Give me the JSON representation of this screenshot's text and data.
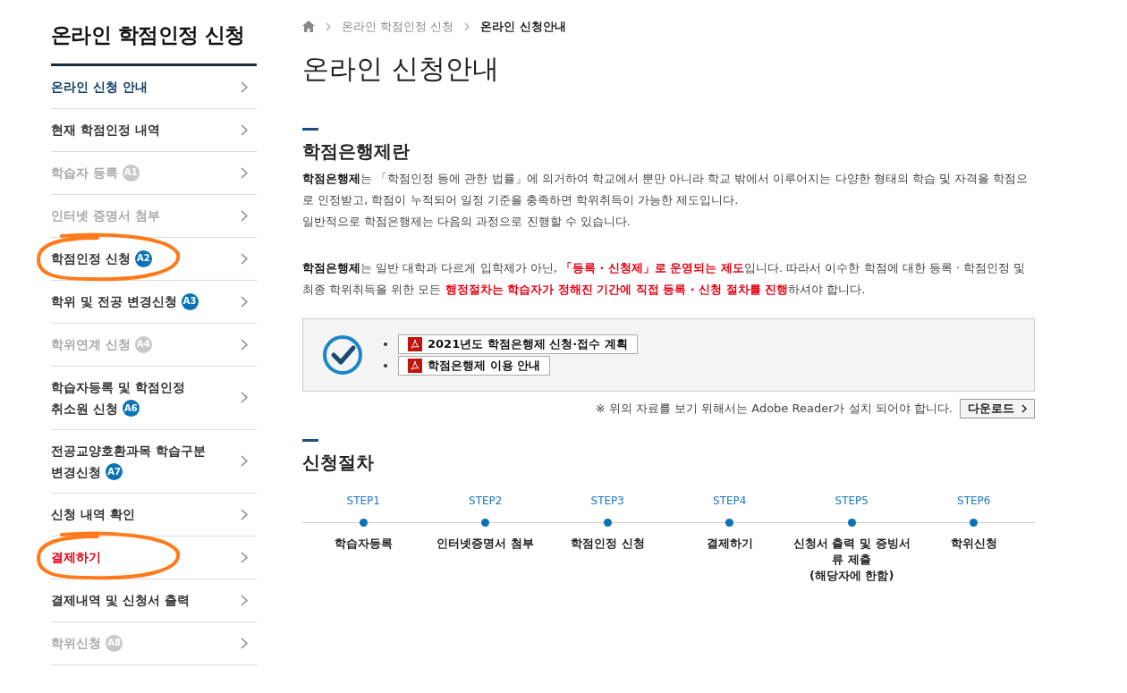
{
  "sidebar": {
    "title": "온라인 학점인정 신청",
    "items": [
      {
        "label": "온라인 신청 안내",
        "kind": "current",
        "circled": false
      },
      {
        "label": "현재 학점인정 내역",
        "kind": "normal",
        "circled": false
      },
      {
        "label": "학습자 등록",
        "kind": "disabled",
        "badge": "A1",
        "circled": false
      },
      {
        "label": "인터넷 증명서 첨부",
        "kind": "disabled",
        "circled": false
      },
      {
        "label": "학점인정 신청",
        "kind": "normal",
        "badge": "A2",
        "circled": true
      },
      {
        "label": "학위 및 전공 변경신청",
        "kind": "normal",
        "badge": "A3",
        "circled": false
      },
      {
        "label": "학위연계 신청",
        "kind": "disabled",
        "badge": "A4",
        "circled": false
      },
      {
        "label": "학습자등록 및 학점인정\n취소원 신청",
        "kind": "normal",
        "badge": "A6",
        "circled": false
      },
      {
        "label": "전공교양호환과목 학습구분\n변경신청",
        "kind": "normal",
        "badge": "A7",
        "circled": false
      },
      {
        "label": "신청 내역 확인",
        "kind": "normal",
        "circled": false
      },
      {
        "label": "결제하기",
        "kind": "alert",
        "circled": true
      },
      {
        "label": "결제내역 및 신청서 출력",
        "kind": "normal",
        "circled": false
      },
      {
        "label": "학위신청",
        "kind": "disabled",
        "badge": "A8",
        "circled": false
      }
    ]
  },
  "breadcrumb": [
    "온라인 학점인정 신청",
    "온라인 신청안내"
  ],
  "page_title": "온라인 신청안내",
  "intro": {
    "heading": "학점은행제란",
    "paragraph_1": "**학점은행제**는 「학점인정 등에 관한 법률」에 의거하여 학교에서 뿐만 아니라 학교 밖에서 이루어지는 다양한 형태의 학습 및 자격을 학점으로 인정받고, 학점이 누적되어 일정 기준을 충족하면 학위취득이 가능한 제도입니다.",
    "paragraph_2": "일반적으로 학점은행제는 다음의 과정으로 진행할 수 있습니다.",
    "paragraph_3": [
      {
        "kind": "bold",
        "text": "학점은행제"
      },
      {
        "kind": "plain",
        "text": "는 일반 대학과 다르게 입학제가 아닌, "
      },
      {
        "kind": "red",
        "text": "「등록 · 신청제」로 운영되는 제도"
      },
      {
        "kind": "plain",
        "text": "입니다. 따라서 이수한 학점에 대한 등록 · 학점인정 및 최종 학위취득을 위한 모든 "
      },
      {
        "kind": "red",
        "text": "행정절차는 학습자가 정해진 기간에 직접 등록 · 신청 절차를 진행"
      },
      {
        "kind": "plain",
        "text": "하셔야 합니다."
      }
    ]
  },
  "documents": [
    "2021년도 학점은행제 신청·접수 계획",
    "학점은행제 이용 안내"
  ],
  "download_note": "※ 위의 자료를 보기 위해서는 Adobe Reader가 설치 되어야 합니다.",
  "download_button": "다운로드",
  "procedure": {
    "heading": "신청절차",
    "steps": [
      {
        "step": "STEP1",
        "label": "학습자등록"
      },
      {
        "step": "STEP2",
        "label": "인터넷증명서 첨부"
      },
      {
        "step": "STEP3",
        "label": "학점인정 신청"
      },
      {
        "step": "STEP4",
        "label": "결제하기"
      },
      {
        "step": "STEP5",
        "label": "신청서 출력 및 증빙서\n류 제출\n(해당자에 한함)"
      },
      {
        "step": "STEP6",
        "label": "학위신청"
      }
    ]
  }
}
